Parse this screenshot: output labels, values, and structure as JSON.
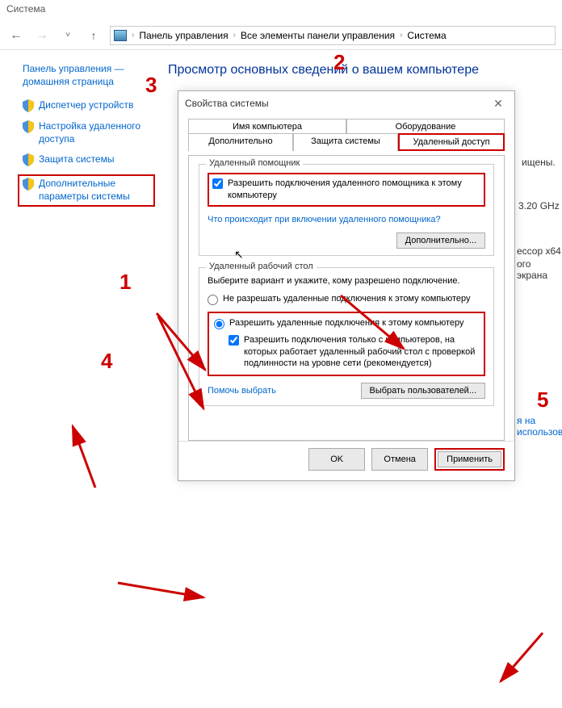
{
  "titlebar": {
    "title": "Система"
  },
  "navbar": {
    "breadcrumbs": [
      "Панель управления",
      "Все элементы панели управления",
      "Система"
    ]
  },
  "sidebar": {
    "home": "Панель управления — домашняя страница",
    "items": [
      {
        "label": "Диспетчер устройств"
      },
      {
        "label": "Настройка удаленного доступа"
      },
      {
        "label": "Защита системы"
      },
      {
        "label": "Дополнительные параметры системы"
      }
    ]
  },
  "content": {
    "title": "Просмотр основных сведений о вашем компьютере",
    "peek1": "ищены.",
    "peek2": "3.20 GHz",
    "peek3": "ессор x64",
    "peek4": "ого экрана",
    "peek5": "я на использов"
  },
  "dialog": {
    "title": "Свойства системы",
    "tabs": {
      "top": [
        "Имя компьютера",
        "Оборудование"
      ],
      "bottom": [
        "Дополнительно",
        "Защита системы",
        "Удаленный доступ"
      ]
    },
    "assistant": {
      "legend": "Удаленный помощник",
      "checkbox": "Разрешить подключения удаленного помощника к этому компьютеру",
      "link": "Что происходит при включении удаленного помощника?",
      "button": "Дополнительно..."
    },
    "desktop": {
      "legend": "Удаленный рабочий стол",
      "desc": "Выберите вариант и укажите, кому разрешено подключение.",
      "radio_deny": "Не разрешать удаленные подключения к этому компьютеру",
      "radio_allow": "Разрешить удаленные подключения к этому компьютеру",
      "nla_checkbox": "Разрешить подключения только с компьютеров, на которых работает удаленный рабочий стол с проверкой подлинности на уровне сети (рекомендуется)",
      "help_link": "Помочь выбрать",
      "users_button": "Выбрать пользователей..."
    },
    "buttons": {
      "ok": "OK",
      "cancel": "Отмена",
      "apply": "Применить"
    }
  },
  "annotations": {
    "n1": "1",
    "n2": "2",
    "n3": "3",
    "n4": "4",
    "n5": "5"
  }
}
